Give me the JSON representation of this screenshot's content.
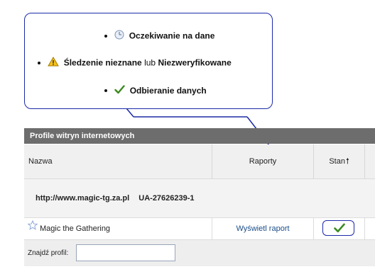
{
  "legend": {
    "waiting_label": "Oczekiwanie na dane",
    "tracking_label_a": "Śledzenie nieznane",
    "tracking_conj": "lub",
    "tracking_label_b": "Niezweryfikowane",
    "receiving_label": "Odbieranie danych"
  },
  "icons": {
    "waiting": "clock-icon",
    "tracking": "warning-icon",
    "receiving": "checkmark-icon",
    "star": "star-icon",
    "sort": "sort-up-icon"
  },
  "colors": {
    "callout_border": "#1b2aa8",
    "panel_header_bg": "#6d6d6d",
    "link": "#1a4e8a",
    "check_green": "#3a8a1f"
  },
  "panel": {
    "title": "Profile witryn internetowych",
    "columns": {
      "name": "Nazwa",
      "reports": "Raporty",
      "status": "Stan"
    },
    "account": {
      "url": "http://www.magic-tg.za.pl",
      "ua_id": "UA-27626239-1"
    },
    "profiles": [
      {
        "name": "Magic the Gathering",
        "report_link": "Wyświetl raport",
        "status": "receiving"
      }
    ],
    "find": {
      "label": "Znajdź profil:",
      "value": "",
      "placeholder": ""
    }
  }
}
